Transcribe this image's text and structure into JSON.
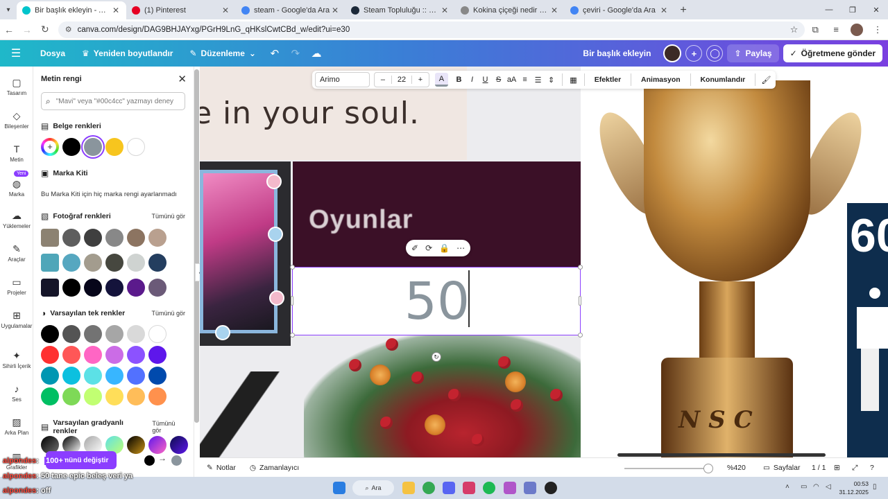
{
  "browser": {
    "tabs": [
      {
        "title": "Bir başlık ekleyin - A4 (Yatay)",
        "color": "#00c4cc",
        "active": true
      },
      {
        "title": "(1) Pinterest",
        "color": "#e60023",
        "active": false
      },
      {
        "title": "steam - Google'da Ara",
        "color": "#4285f4",
        "active": false
      },
      {
        "title": "Steam Topluluğu :: aysmile",
        "color": "#1b2838",
        "active": false
      },
      {
        "title": "Kokina çiçeği nedir - TrKayseri",
        "color": "#888888",
        "active": false
      },
      {
        "title": "çeviri - Google'da Ara",
        "color": "#4285f4",
        "active": false
      }
    ],
    "url": "canva.com/design/DAG9BHJAYxg/PGrH9LnG_qHKslCwtCBd_w/edit?ui=e30"
  },
  "header": {
    "file": "Dosya",
    "resize": "Yeniden boyutlandır",
    "editing": "Düzenleme",
    "title": "Bir başlık ekleyin",
    "share": "Paylaş",
    "teacher": "Öğretmene gönder"
  },
  "rail": {
    "items": [
      {
        "label": "Tasarım",
        "icon": "▢"
      },
      {
        "label": "Bileşenler",
        "icon": "◇"
      },
      {
        "label": "Metin",
        "icon": "T"
      },
      {
        "label": "Marka",
        "icon": "◍"
      },
      {
        "label": "Yüklemeler",
        "icon": "☁"
      },
      {
        "label": "Araçlar",
        "icon": "✎"
      },
      {
        "label": "Projeler",
        "icon": "▭"
      },
      {
        "label": "Uygulamalar",
        "icon": "⊞"
      },
      {
        "label": "Sihirli İçerik",
        "icon": "✦"
      },
      {
        "label": "Ses",
        "icon": "♪"
      },
      {
        "label": "Arka Plan",
        "icon": "▨"
      },
      {
        "label": "Grafikler",
        "icon": "▥"
      }
    ],
    "new_badge": "Yeni"
  },
  "panel": {
    "title": "Metin rengi",
    "search_placeholder": "\"Mavi\" veya \"#00c4cc\" yazmayı deney",
    "doc_colors_title": "Belge renkleri",
    "doc_colors": [
      "#000000",
      "#8a959d",
      "#f7c51e",
      "#ffffff"
    ],
    "brand_title": "Marka Kiti",
    "brand_note": "Bu Marka Kiti için hiç marka rengi ayarlanmadı",
    "photo_title": "Fotoğraf renkleri",
    "see_all": "Tümünü gör",
    "photo_rows": [
      {
        "thumb": "#8c8272",
        "colors": [
          "#5e5e5e",
          "#3f3f3f",
          "#888888",
          "#8c7461",
          "#b9a08f"
        ]
      },
      {
        "thumb": "#4fa6b9",
        "colors": [
          "#56a7c0",
          "#a39c8e",
          "#46473f",
          "#cfd3d1",
          "#243e5f"
        ]
      },
      {
        "thumb": "#151528",
        "colors": [
          "#000000",
          "#07061a",
          "#14133b",
          "#5b1a8c",
          "#6b5a78"
        ]
      }
    ],
    "solid_title": "Varsayılan tek renkler",
    "solid_rows": [
      [
        "#000000",
        "#545454",
        "#737373",
        "#a6a6a6",
        "#d9d9d9",
        "#ffffff"
      ],
      [
        "#ff3131",
        "#ff5757",
        "#ff66c4",
        "#cb6ce6",
        "#8c52ff",
        "#5e17eb"
      ],
      [
        "#0097b2",
        "#0cc0df",
        "#5ce1e6",
        "#38b6ff",
        "#5271ff",
        "#004aad"
      ],
      [
        "#00bf63",
        "#7ed957",
        "#c1ff72",
        "#ffde59",
        "#ffbd59",
        "#ff914d"
      ]
    ],
    "gradient_title": "Varsayılan gradyanlı renkler",
    "replace_label": "Tümünü değiştir"
  },
  "toolbar": {
    "font": "Arimo",
    "size": "22",
    "effects": "Efektler",
    "animate": "Animasyon",
    "position": "Konumlandır"
  },
  "canvas": {
    "soul_text": "e in your soul.",
    "oyunlar": "Oyunlar",
    "number": "50",
    "trophy_text": "NSC",
    "navy_text": "60"
  },
  "bottom": {
    "notes": "Notlar",
    "timer": "Zamanlayıcı",
    "zoom": "%420",
    "pages": "Sayfalar",
    "page_count": "1 / 1"
  },
  "taskbar": {
    "search": "Ara",
    "time": "00:53",
    "date": "31.12.2025"
  },
  "chat": [
    {
      "user": "alpondes",
      "text": ": ",
      "badge": "100+"
    },
    {
      "user": "alpondes",
      "text": ": 50 tane epic beleş veri ya"
    },
    {
      "user": "alpondes",
      "text": ": off"
    }
  ]
}
